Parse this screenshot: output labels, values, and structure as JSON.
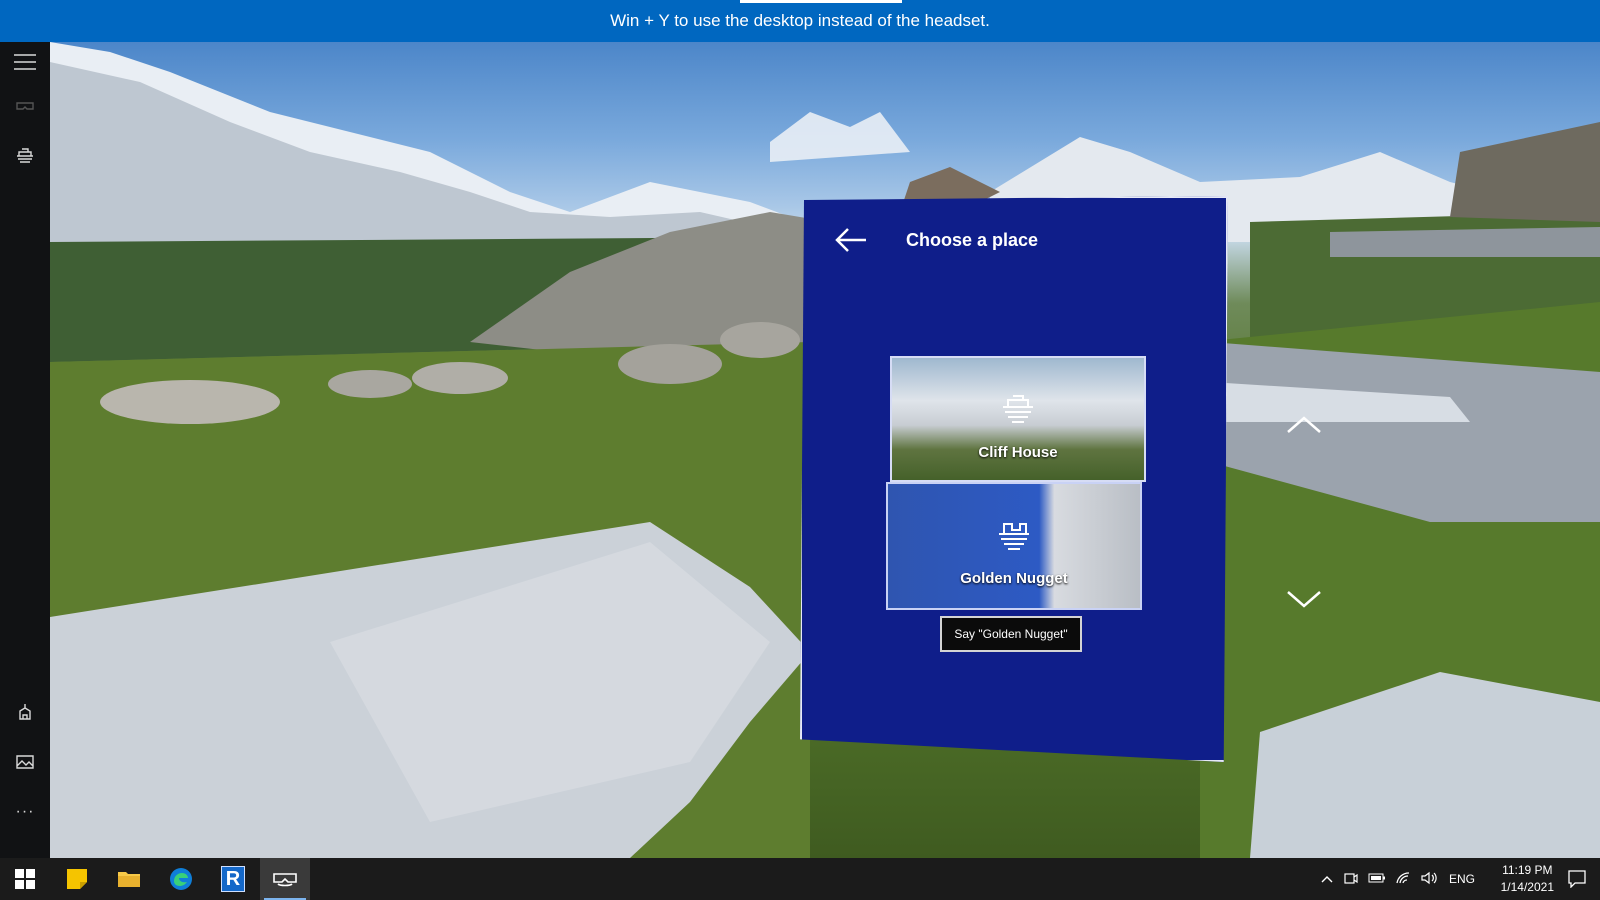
{
  "banner": {
    "text": "Win + Y to use the desktop instead of the headset."
  },
  "rail": {
    "items": [
      {
        "name": "menu-icon"
      },
      {
        "name": "headset-icon"
      },
      {
        "name": "cliff-house-icon"
      },
      {
        "name": "home-pin-icon"
      },
      {
        "name": "photo-icon"
      },
      {
        "name": "more-icon",
        "label": "···"
      }
    ]
  },
  "panel": {
    "title": "Choose a place",
    "places": [
      {
        "label": "Cliff House",
        "icon": "cliff-house-icon"
      },
      {
        "label": "Golden Nugget",
        "icon": "golden-nugget-icon"
      }
    ],
    "voice_hint": "Say \"Golden Nugget\""
  },
  "taskbar": {
    "apps": [
      {
        "name": "start-button",
        "icon": "windows-icon"
      },
      {
        "name": "sticky-notes",
        "icon": "sticky-notes-icon"
      },
      {
        "name": "file-explorer",
        "icon": "folder-icon"
      },
      {
        "name": "edge",
        "icon": "edge-icon"
      },
      {
        "name": "revit",
        "icon": "revit-icon",
        "letter": "R"
      },
      {
        "name": "mixed-reality-portal",
        "icon": "headset-icon"
      }
    ],
    "language": "ENG",
    "time": "11:19 PM",
    "date": "1/14/2021"
  },
  "colors": {
    "banner": "#0067c0",
    "panel": "#0f1e8a",
    "taskbar": "#1b1b1b"
  }
}
